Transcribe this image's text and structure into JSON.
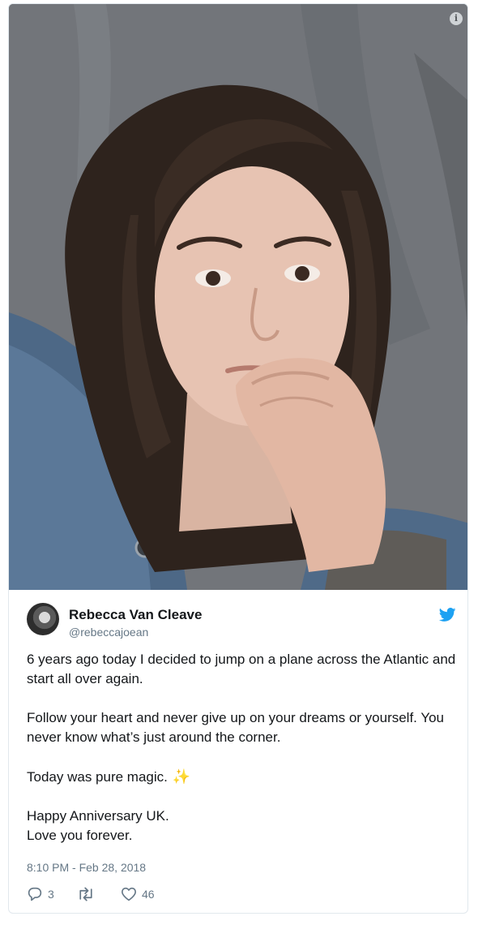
{
  "tweet": {
    "author_name": "Rebecca Van Cleave",
    "author_handle": "@rebeccajoean",
    "paragraphs": [
      "6 years ago today I decided to jump on a plane across the Atlantic and start all over again.",
      "Follow your heart and never give up on your dreams or yourself. You never know what’s just around the corner.",
      "Today was pure magic."
    ],
    "closing_line1": "Happy Anniversary UK.",
    "closing_line2": "Love you forever.",
    "timestamp": "8:10 PM - Feb 28, 2018",
    "reply_count": "3",
    "like_count": "46"
  },
  "icons": {
    "info": "info-icon",
    "bird": "twitter-bird-icon",
    "sparkle": "sparkles-icon",
    "reply": "reply-icon",
    "retweet": "retweet-icon",
    "like": "heart-icon"
  },
  "colors": {
    "twitter_blue": "#1da1f2",
    "meta_gray": "#657786"
  }
}
